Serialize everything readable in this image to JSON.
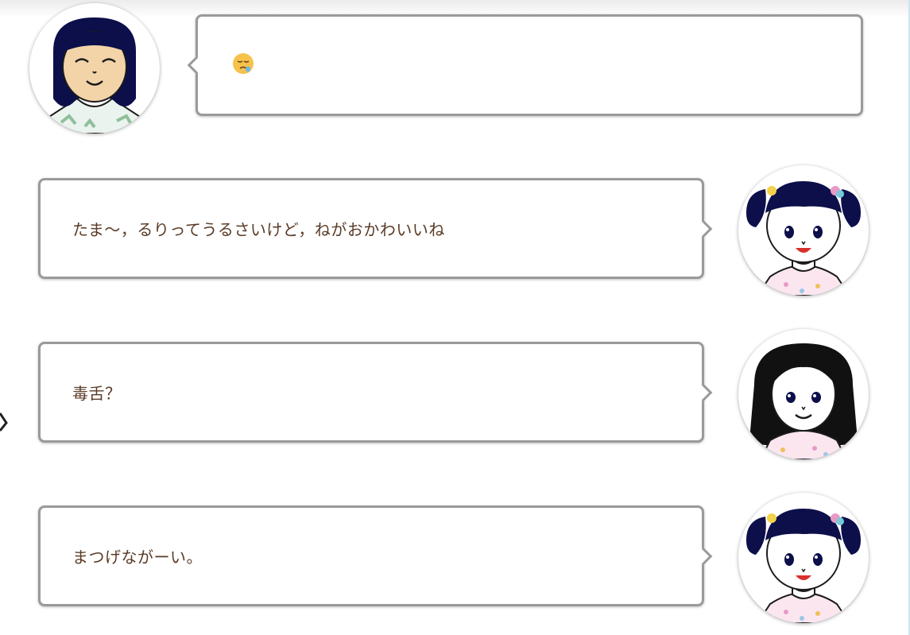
{
  "messages": [
    {
      "speaker": "left-character",
      "text": "",
      "emoji": "sleepy-face"
    },
    {
      "speaker": "right-character-1",
      "text": "たま〜，るりってうるさいけど，ねがおかわいいね"
    },
    {
      "speaker": "right-character-2",
      "text": "毒舌？"
    },
    {
      "speaker": "right-character-1",
      "text": "まつげながーい。"
    }
  ],
  "colors": {
    "text": "#5a3b26",
    "bubble_border": "#9a9a9a",
    "hair": "#0c0f4a",
    "skin": "#f3d3a8"
  }
}
